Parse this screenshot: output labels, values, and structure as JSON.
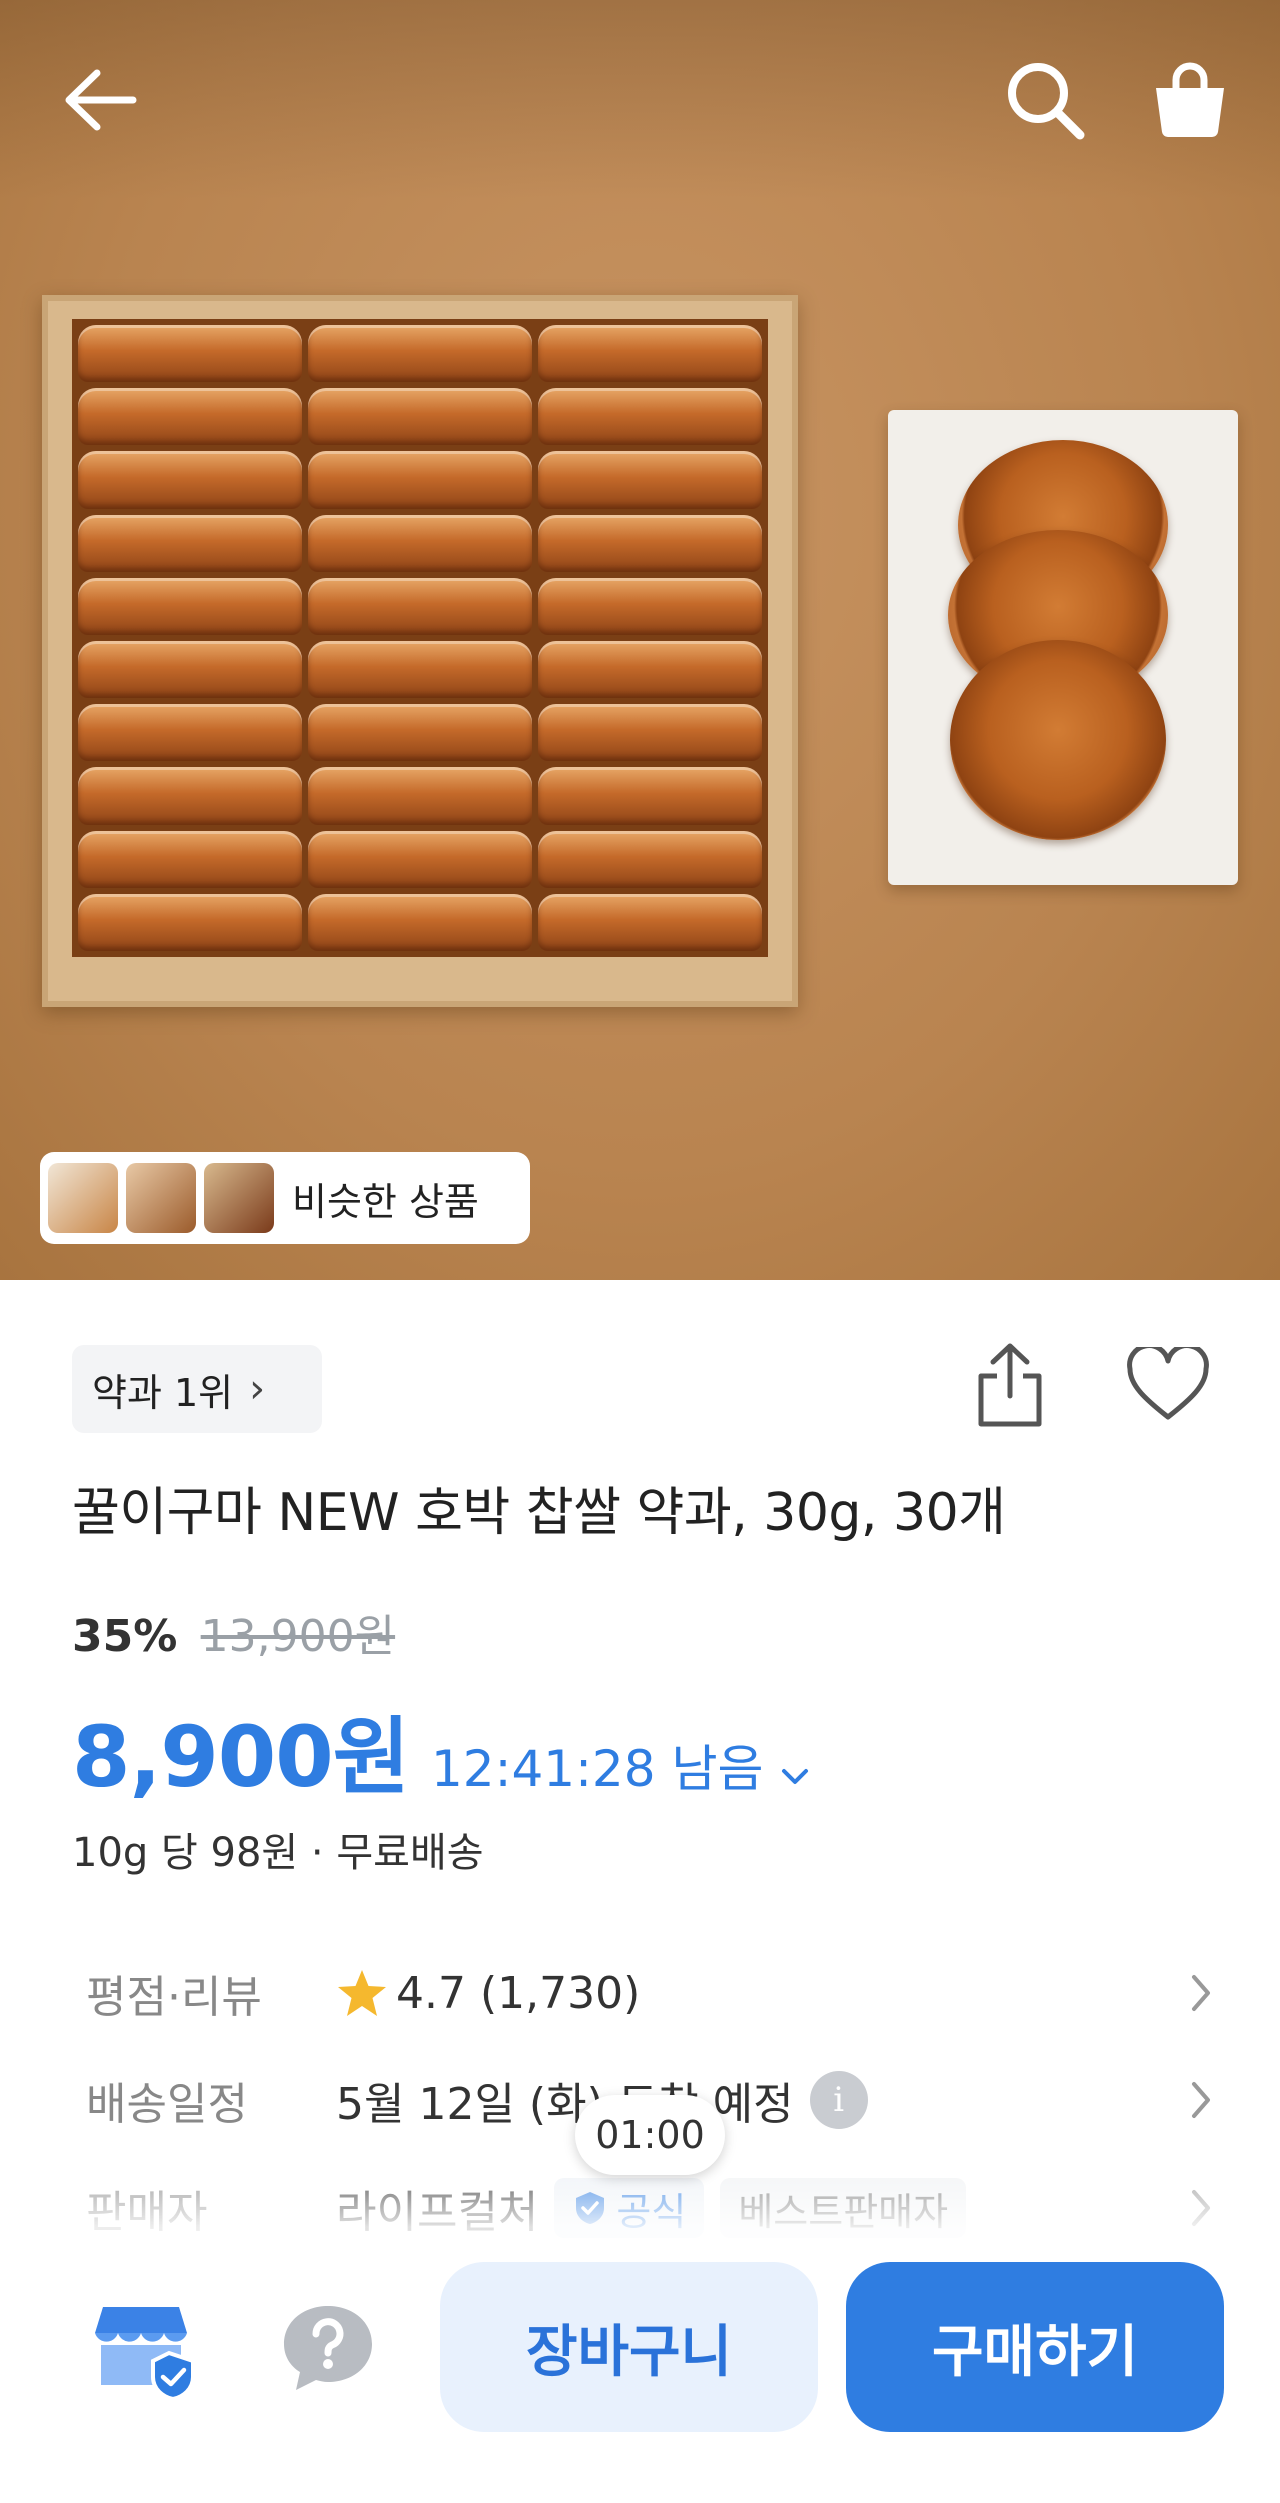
{
  "header": {
    "back_icon": "arrow-left-icon",
    "search_icon": "search-icon",
    "cart_icon": "shopping-bag-icon"
  },
  "gallery": {
    "similar_label": "비슷한 상품"
  },
  "product": {
    "rank_label": "약과 1위",
    "rank_chevron": "›",
    "title": "꿀이구마 NEW 호박 찹쌀 약과, 30g, 30개",
    "discount_rate": "35%",
    "original_price": "13,900원",
    "sale_price": "8,900원",
    "timer": "12:41:28 남음",
    "unit_info": "10g 당 98원 · 무료배송"
  },
  "info_rows": {
    "rating_label": "평점·리뷰",
    "rating_value": "4.7 (1,730)",
    "delivery_label": "배송일정",
    "delivery_value": "5월 12일 (화) 도착 예정",
    "seller_label": "판매자",
    "seller_name": "라이프컬처",
    "badge_official": "공식",
    "badge_best": "베스트판매자"
  },
  "floating": {
    "time_pill": "01:00"
  },
  "bottom_bar": {
    "cart_label": "장바구니",
    "buy_label": "구매하기"
  },
  "colors": {
    "accent": "#2f7de1",
    "cart_bg": "#e8f1fd",
    "star": "#f5b82e"
  }
}
